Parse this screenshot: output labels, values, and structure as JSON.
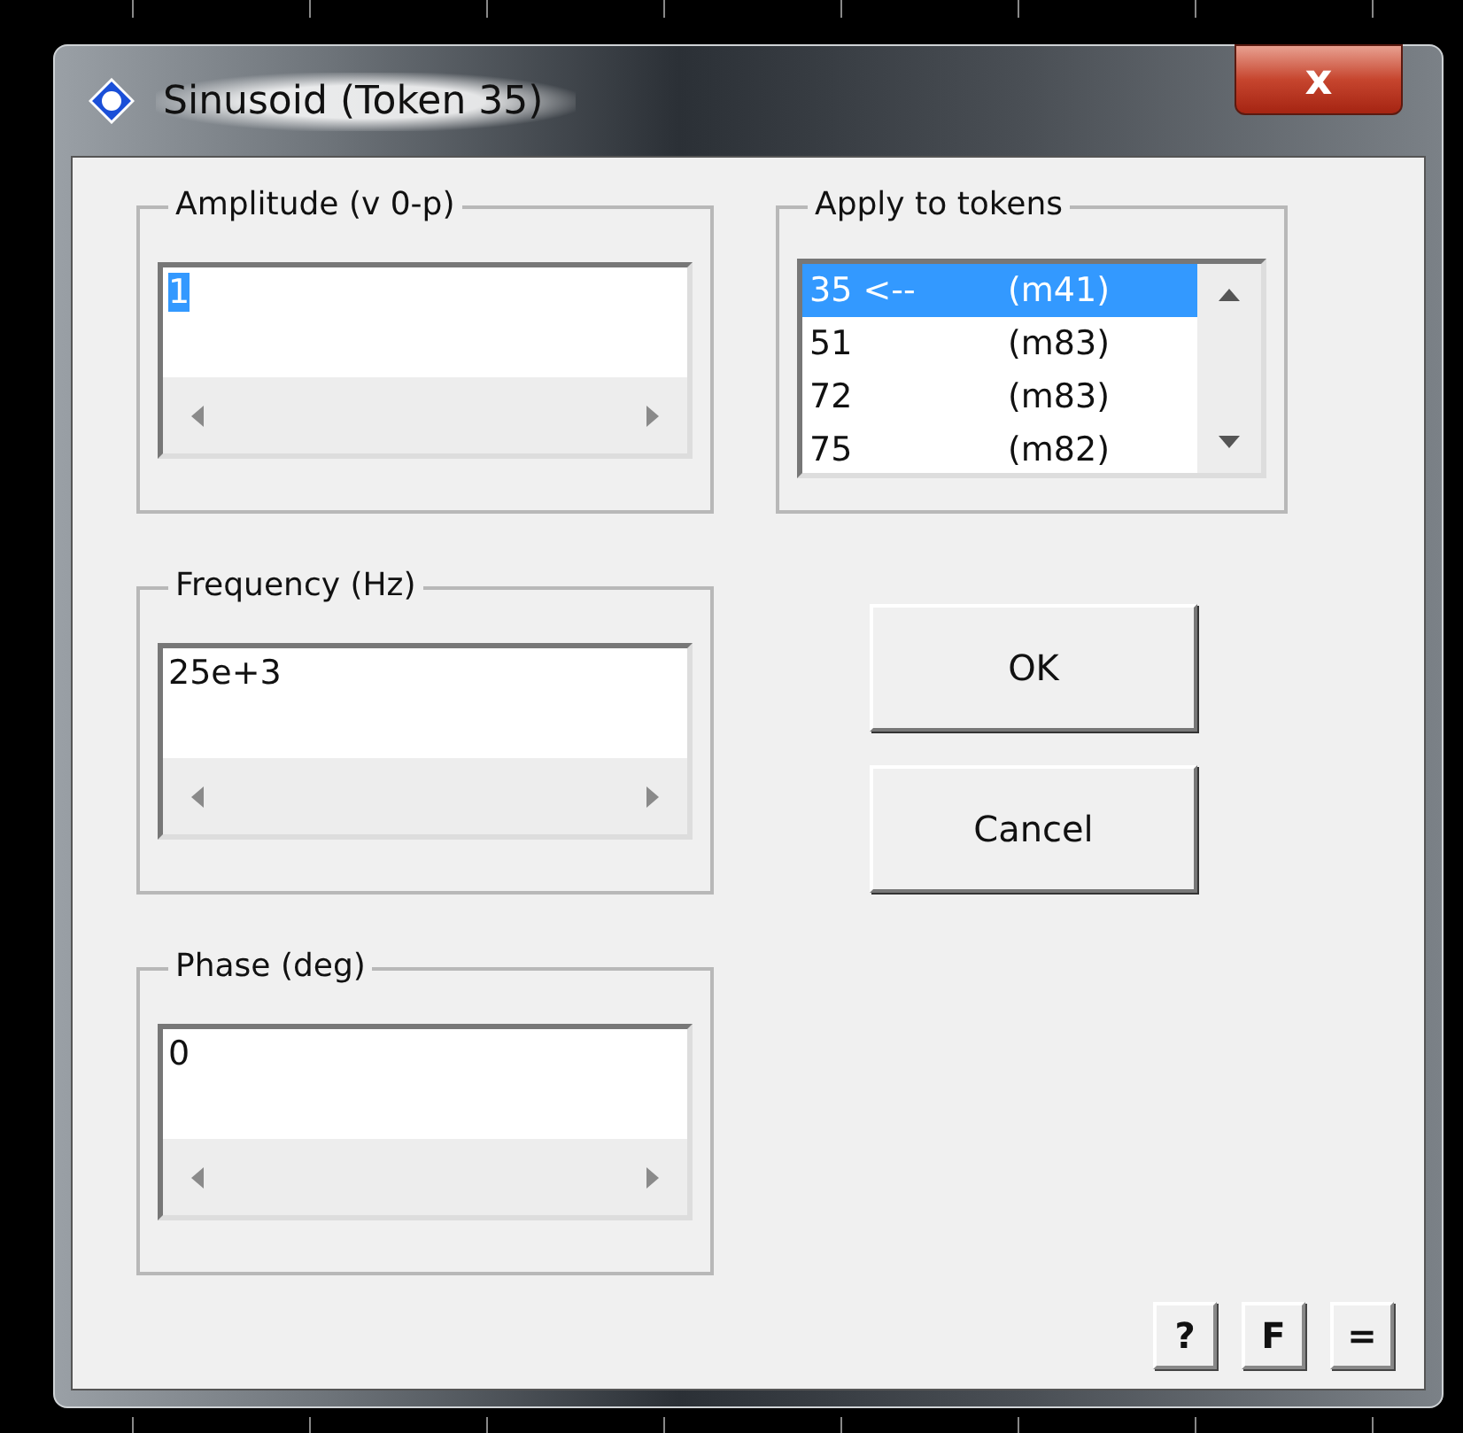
{
  "window": {
    "title": "Sinusoid (Token 35)",
    "close": "x"
  },
  "fields": [
    {
      "label": "Amplitude (v 0-p)",
      "value": "1",
      "text_selected": true
    },
    {
      "label": "Frequency (Hz)",
      "value": "25e+3",
      "text_selected": false
    },
    {
      "label": "Phase (deg)",
      "value": "0",
      "text_selected": false
    }
  ],
  "tokens": {
    "label": "Apply to tokens",
    "items": [
      {
        "token": "35 <--",
        "model": "(m41)",
        "selected": true
      },
      {
        "token": "51",
        "model": "(m83)",
        "selected": false
      },
      {
        "token": "72",
        "model": "(m83)",
        "selected": false
      },
      {
        "token": "75",
        "model": "(m82)",
        "selected": false
      }
    ]
  },
  "buttons": [
    "OK",
    "Cancel"
  ],
  "small_buttons": [
    "?",
    "F",
    "="
  ]
}
